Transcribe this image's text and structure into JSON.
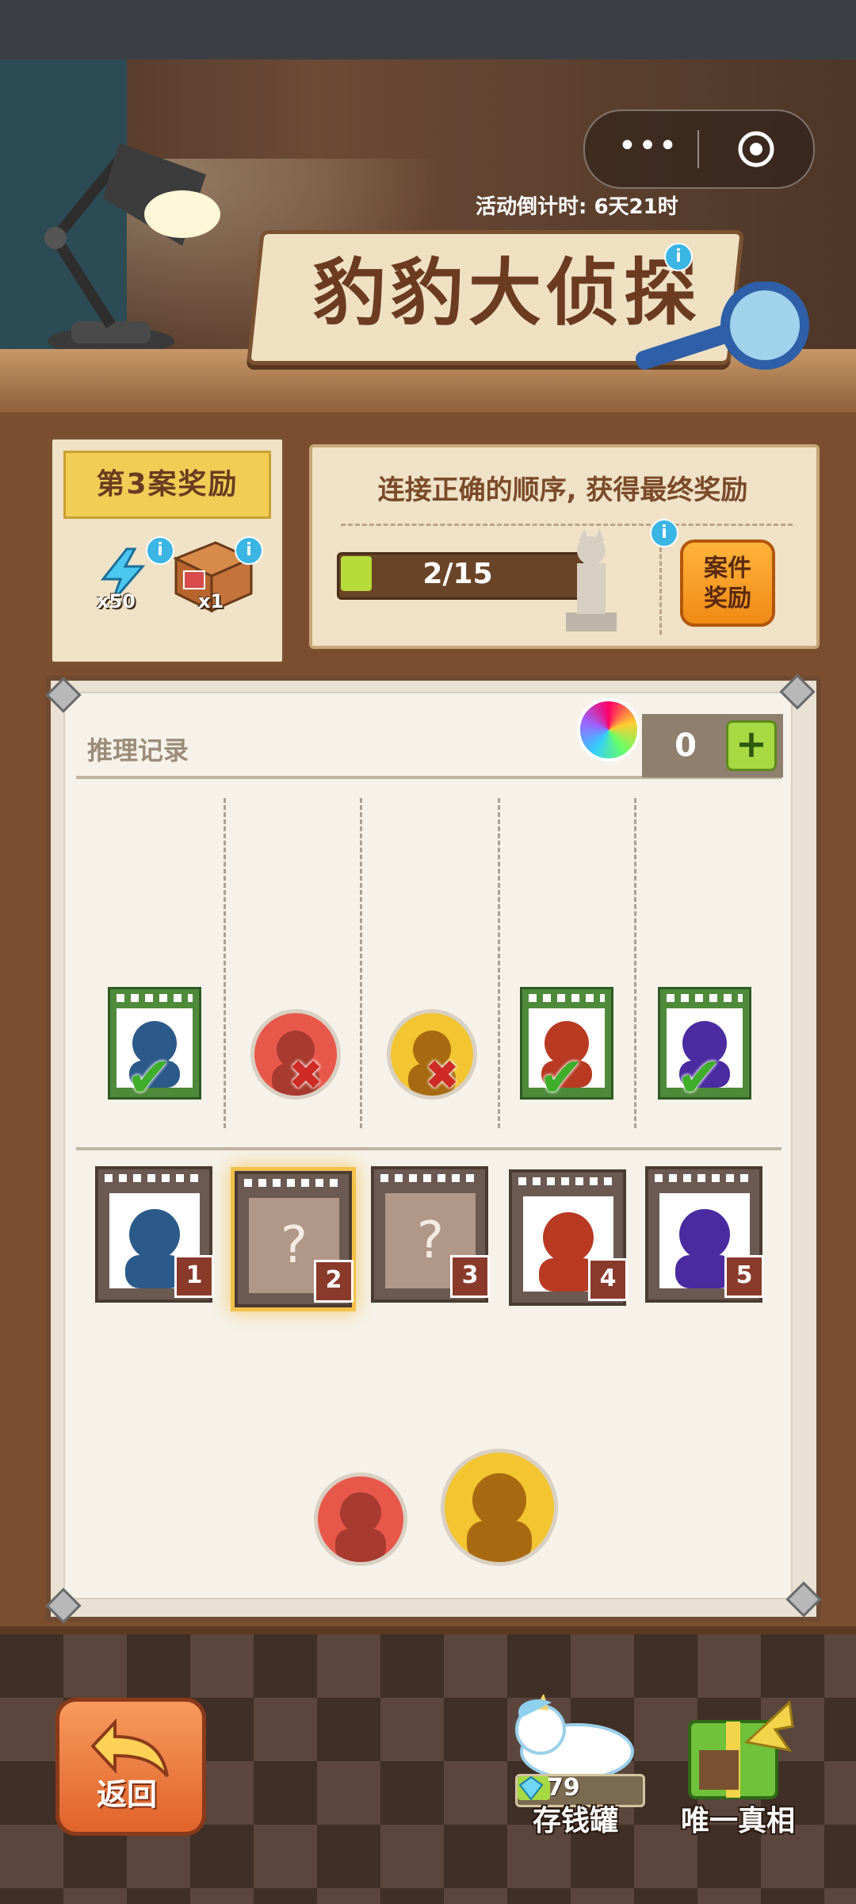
{
  "header": {
    "countdown_label": "活动倒计时: 6天21时",
    "title": "豹豹大侦探",
    "info_icon": "i"
  },
  "mini_program": {
    "more_icon": "•••",
    "close_icon": "target-icon"
  },
  "reward": {
    "banner": "第3案奖励",
    "items": [
      {
        "icon": "lightning-icon",
        "qty": "x50"
      },
      {
        "icon": "crate-icon",
        "qty": "x1"
      }
    ]
  },
  "objective": {
    "text": "连接正确的顺序, 获得最终奖励",
    "progress_label": "2/15",
    "progress_value": 0.133,
    "case_reward_button": "案件\n奖励"
  },
  "record": {
    "label": "推理记录",
    "counter": "0",
    "plus": "+"
  },
  "history": [
    {
      "type": "card",
      "color": "#2b5a8a",
      "result": "correct"
    },
    {
      "type": "token",
      "color": "#a83a30",
      "bg": "#e8584a",
      "result": "wrong"
    },
    {
      "type": "token",
      "color": "#a86a10",
      "bg": "#f2c531",
      "result": "wrong"
    },
    {
      "type": "card",
      "color": "#b83a22",
      "result": "correct"
    },
    {
      "type": "card",
      "color": "#4a2ba0",
      "result": "correct"
    }
  ],
  "slots": [
    {
      "number": "1",
      "state": "filled",
      "color": "#2b5a8a"
    },
    {
      "number": "2",
      "state": "unknown",
      "label": "?"
    },
    {
      "number": "3",
      "state": "unknown",
      "label": "?"
    },
    {
      "number": "4",
      "state": "filled",
      "color": "#b83a22"
    },
    {
      "number": "5",
      "state": "filled",
      "color": "#4a2ba0"
    }
  ],
  "tokens": [
    {
      "color": "#a83a30",
      "bg": "#e8584a"
    },
    {
      "color": "#a86a10",
      "bg": "#f2c531"
    }
  ],
  "bottom": {
    "back_label": "返回",
    "piggy_bank_label": "存钱罐",
    "piggy_gems": "79",
    "piggy_fill": 0.27,
    "truth_label": "唯一真相"
  }
}
